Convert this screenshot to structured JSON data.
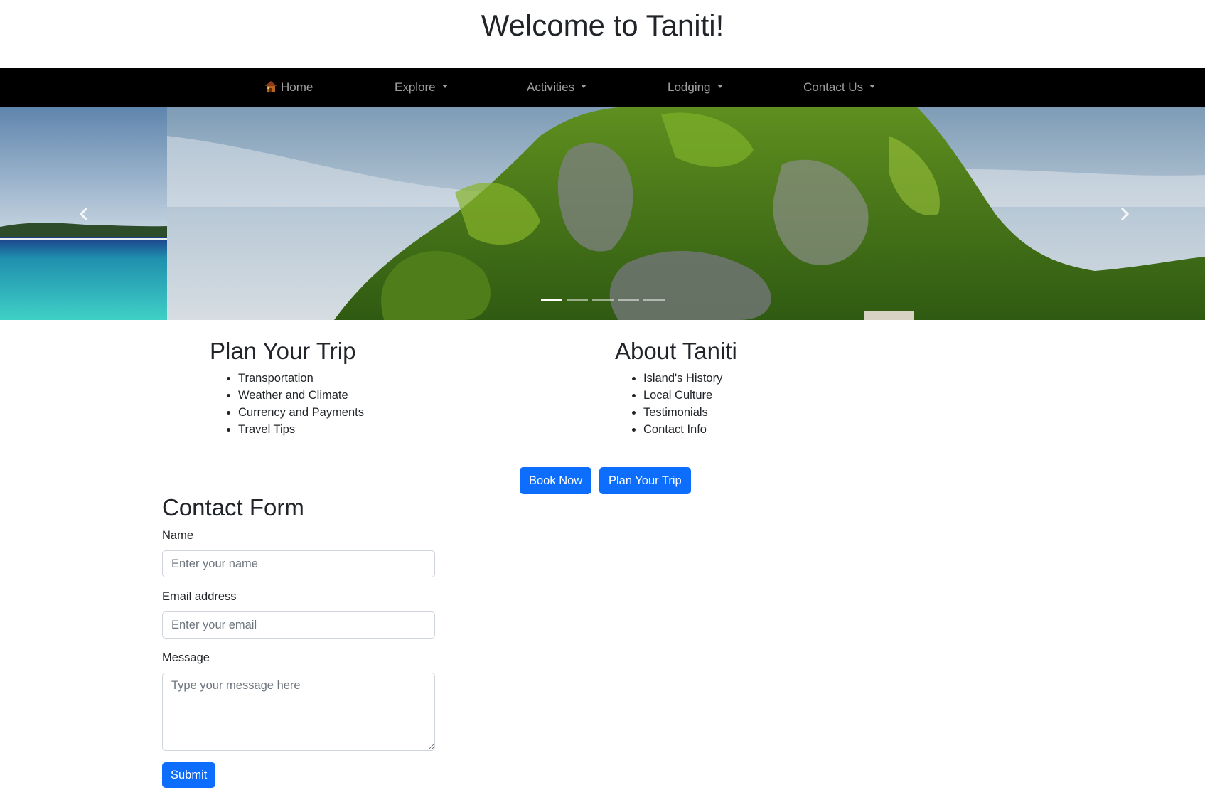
{
  "header": {
    "title": "Welcome to Taniti!"
  },
  "nav": {
    "items": [
      {
        "label": "Home",
        "icon": "home-icon",
        "dropdown": false
      },
      {
        "label": "Explore",
        "dropdown": true
      },
      {
        "label": "Activities",
        "dropdown": true
      },
      {
        "label": "Lodging",
        "dropdown": true
      },
      {
        "label": "Contact Us",
        "dropdown": true
      }
    ]
  },
  "carousel": {
    "slide_count": 5,
    "active_index": 0,
    "prev_icon": "chevron-left-icon",
    "next_icon": "chevron-right-icon"
  },
  "plan_section": {
    "title": "Plan Your Trip",
    "items": [
      "Transportation",
      "Weather and Climate",
      "Currency and Payments",
      "Travel Tips"
    ]
  },
  "about_section": {
    "title": "About Taniti",
    "items": [
      "Island's History",
      "Local Culture",
      "Testimonials",
      "Contact Info"
    ]
  },
  "actions": {
    "book_now": "Book Now",
    "plan_trip": "Plan Your Trip"
  },
  "contact_form": {
    "title": "Contact Form",
    "name_label": "Name",
    "name_placeholder": "Enter your name",
    "name_value": "",
    "email_label": "Email address",
    "email_placeholder": "Enter your email",
    "email_value": "",
    "message_label": "Message",
    "message_placeholder": "Type your message here",
    "message_value": "",
    "submit_label": "Submit"
  },
  "colors": {
    "primary": "#0d6efd",
    "navbar_bg": "#000000",
    "nav_text": "#9e9e9e"
  }
}
